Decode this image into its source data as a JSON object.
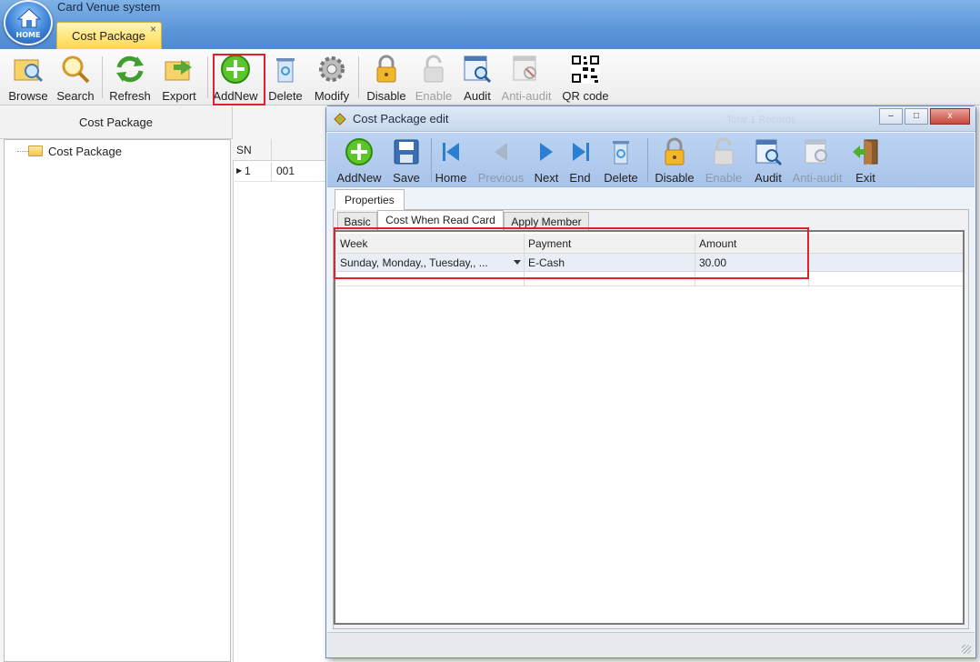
{
  "app": {
    "title": "Card Venue system",
    "home_label": "HOME"
  },
  "main_tab": {
    "label": "Cost Package",
    "close": "×"
  },
  "toolbar": [
    {
      "label": "Browse",
      "icon": "browse-icon",
      "enabled": true
    },
    {
      "label": "Search",
      "icon": "search-icon",
      "enabled": true
    },
    {
      "label": "Refresh",
      "icon": "refresh-icon",
      "enabled": true
    },
    {
      "label": "Export",
      "icon": "export-icon",
      "enabled": true
    },
    {
      "label": "AddNew",
      "icon": "add-icon",
      "enabled": true
    },
    {
      "label": "Delete",
      "icon": "trash-icon",
      "enabled": true
    },
    {
      "label": "Modify",
      "icon": "gear-icon",
      "enabled": true
    },
    {
      "label": "Disable",
      "icon": "lock-icon",
      "enabled": true
    },
    {
      "label": "Enable",
      "icon": "unlock-icon",
      "enabled": false
    },
    {
      "label": "Audit",
      "icon": "audit-icon",
      "enabled": true
    },
    {
      "label": "Anti-audit",
      "icon": "anti-audit-icon",
      "enabled": false
    },
    {
      "label": "QR code",
      "icon": "qr-code-icon",
      "enabled": true
    }
  ],
  "left_panel": {
    "title": "Cost Package",
    "tree": [
      "Cost Package"
    ]
  },
  "grid": {
    "col_sn": "SN",
    "rows": [
      {
        "sn": "1",
        "code": "001"
      }
    ]
  },
  "dialog": {
    "title": "Cost Package edit",
    "faded_text": "Total 1 Records",
    "controls": {
      "minimize": "–",
      "maximize": "□",
      "close": "x"
    },
    "toolbar": [
      {
        "label": "AddNew",
        "icon": "add-icon",
        "enabled": true
      },
      {
        "label": "Save",
        "icon": "save-icon",
        "enabled": true
      },
      {
        "label": "Home",
        "icon": "first-record-icon",
        "enabled": true
      },
      {
        "label": "Previous",
        "icon": "previous-icon",
        "enabled": false
      },
      {
        "label": "Next",
        "icon": "next-icon",
        "enabled": true
      },
      {
        "label": "End",
        "icon": "last-record-icon",
        "enabled": true
      },
      {
        "label": "Delete",
        "icon": "trash-icon",
        "enabled": true
      },
      {
        "label": "Disable",
        "icon": "lock-icon",
        "enabled": true
      },
      {
        "label": "Enable",
        "icon": "unlock-icon",
        "enabled": false
      },
      {
        "label": "Audit",
        "icon": "audit-icon",
        "enabled": true
      },
      {
        "label": "Anti-audit",
        "icon": "anti-audit-icon",
        "enabled": false
      },
      {
        "label": "Exit",
        "icon": "exit-icon",
        "enabled": true
      }
    ],
    "properties_tab": "Properties",
    "sub_tabs": [
      "Basic",
      "Cost When Read Card",
      "Apply Member"
    ],
    "active_sub_tab": "Cost When Read Card",
    "table": {
      "headers": [
        "Week",
        "Payment",
        "Amount"
      ],
      "rows": [
        {
          "week": "Sunday, Monday,, Tuesday,, ...",
          "payment": "E-Cash",
          "amount": "30.00"
        }
      ]
    }
  },
  "colors": {
    "highlight": "#e0202a",
    "accent": "#5b95d8",
    "tab_active": "#ffd94a"
  }
}
